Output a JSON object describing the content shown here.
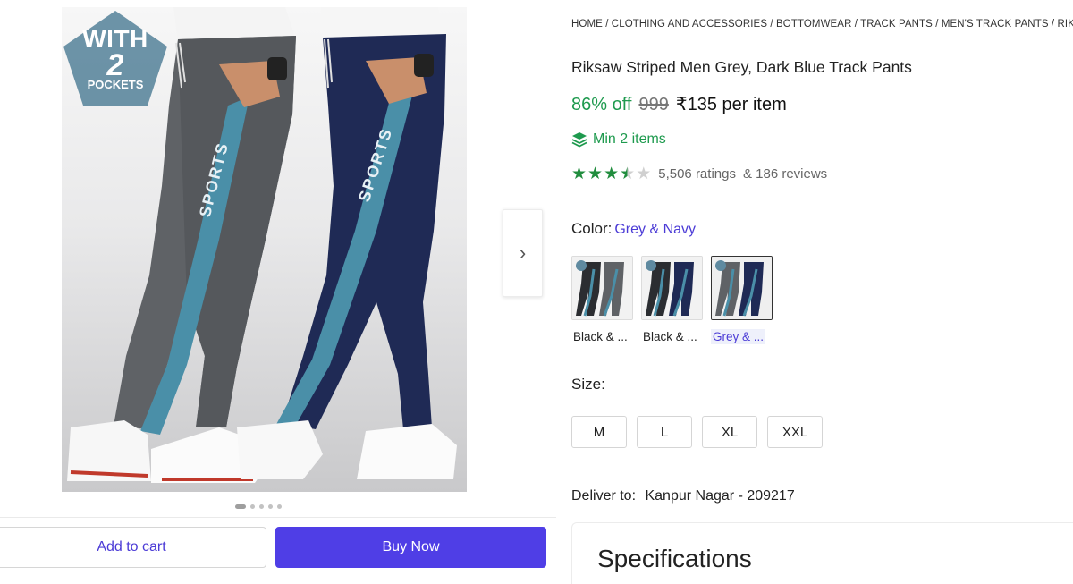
{
  "gallery": {
    "badge": {
      "line1": "WITH",
      "line2": "2",
      "line3": "POCKETS"
    },
    "print_text": "SPORTS",
    "next_arrow": "›",
    "dots_count": 5,
    "active_dot": 0
  },
  "actions": {
    "add_to_cart": "Add to cart",
    "buy_now": "Buy Now"
  },
  "breadcrumb": [
    "HOME",
    "CLOTHING AND ACCESSORIES",
    "BOTTOMWEAR",
    "TRACK PANTS",
    "MEN'S TRACK PANTS",
    "RIKSAW"
  ],
  "product": {
    "title": "Riksaw Striped Men Grey, Dark Blue Track Pants",
    "discount": "86% off",
    "mrp": "999",
    "price": "₹135 per item",
    "min_qty": "Min 2 items",
    "rating_value": 3.5,
    "ratings": "5,506 ratings",
    "reviews": "& 186 reviews"
  },
  "color": {
    "label": "Color:",
    "selected": "Grey & Navy",
    "options": [
      {
        "label": "Black & ...",
        "selected": false
      },
      {
        "label": "Black & ...",
        "selected": false
      },
      {
        "label": "Grey & ...",
        "selected": true
      }
    ]
  },
  "size": {
    "label": "Size:",
    "options": [
      "M",
      "L",
      "XL",
      "XXL"
    ]
  },
  "delivery": {
    "label": "Deliver to:",
    "location": "Kanpur Nagar",
    "pincode": "- 209217"
  },
  "specs": {
    "title": "Specifications"
  },
  "colors": {
    "accent": "#4f3ee6",
    "green": "#1e9a4e",
    "star_green": "#218d3e",
    "grey_pant": "#5f6266",
    "navy_pant": "#1f2a55",
    "stripe": "#4a8fa8"
  }
}
